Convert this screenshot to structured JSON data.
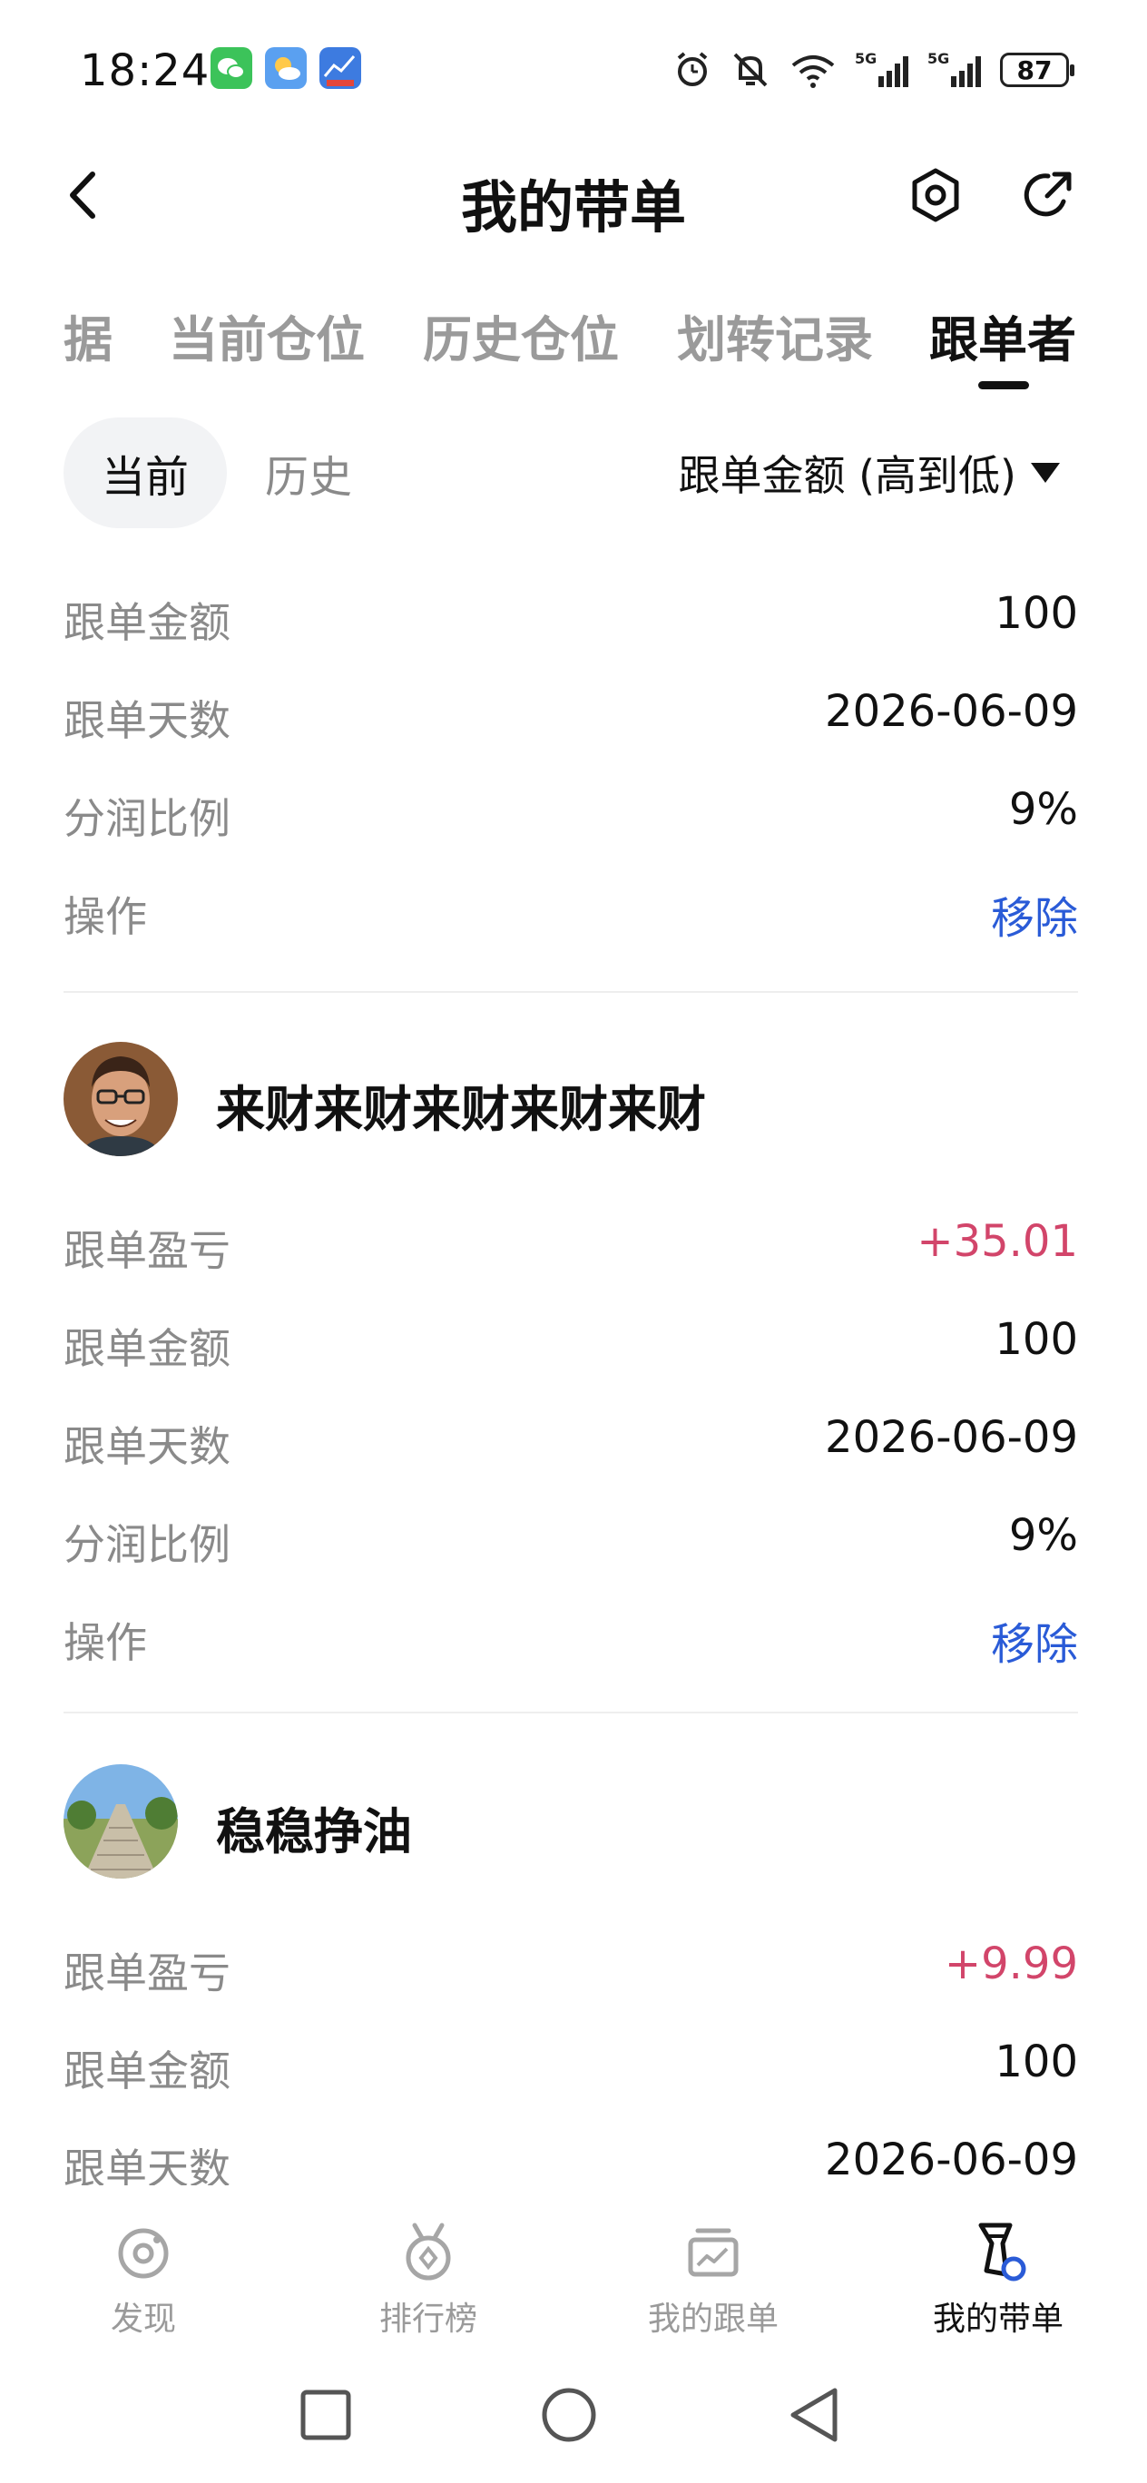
{
  "status_bar": {
    "time": "18:24",
    "battery": "87",
    "icons": [
      "wechat-icon",
      "weather-icon",
      "app-icon",
      "alarm-icon",
      "mute-icon",
      "wifi-icon",
      "signal-5g-icon",
      "signal-5g-icon",
      "battery-icon"
    ]
  },
  "header": {
    "title": "我的带单",
    "icons": [
      "back-icon",
      "settings-icon",
      "share-icon"
    ]
  },
  "tabs": [
    {
      "label": "据"
    },
    {
      "label": "当前仓位"
    },
    {
      "label": "历史仓位"
    },
    {
      "label": "划转记录"
    },
    {
      "label": "跟单者",
      "active": true
    }
  ],
  "filter": {
    "current_label": "当前",
    "history_label": "历史",
    "sort_label": "跟单金额 (高到低)"
  },
  "first_block": {
    "rows": [
      {
        "label": "跟单金额",
        "value": "100"
      },
      {
        "label": "跟单天数",
        "value": "2026-06-09"
      },
      {
        "label": "分润比例",
        "value": "9%"
      },
      {
        "label": "操作",
        "value": "移除"
      }
    ]
  },
  "followers": [
    {
      "name": "来财来财来财来财来财",
      "rows": [
        {
          "label": "跟单盈亏",
          "value": "+35.01"
        },
        {
          "label": "跟单金额",
          "value": "100"
        },
        {
          "label": "跟单天数",
          "value": "2026-06-09"
        },
        {
          "label": "分润比例",
          "value": "9%"
        },
        {
          "label": "操作",
          "value": "移除"
        }
      ]
    },
    {
      "name": "稳稳挣油",
      "rows": [
        {
          "label": "跟单盈亏",
          "value": "+9.99"
        },
        {
          "label": "跟单金额",
          "value": "100"
        },
        {
          "label": "跟单天数",
          "value": "2026-06-09"
        }
      ]
    }
  ],
  "bottom_nav": [
    {
      "label": "发现",
      "icon": "discover-icon"
    },
    {
      "label": "排行榜",
      "icon": "ranking-icon"
    },
    {
      "label": "我的跟单",
      "icon": "my-copy-icon"
    },
    {
      "label": "我的带单",
      "icon": "my-lead-icon",
      "active": true
    }
  ],
  "colors": {
    "profit": "#d2456a",
    "link": "#2a5bd7",
    "muted": "#8a8a8a"
  }
}
